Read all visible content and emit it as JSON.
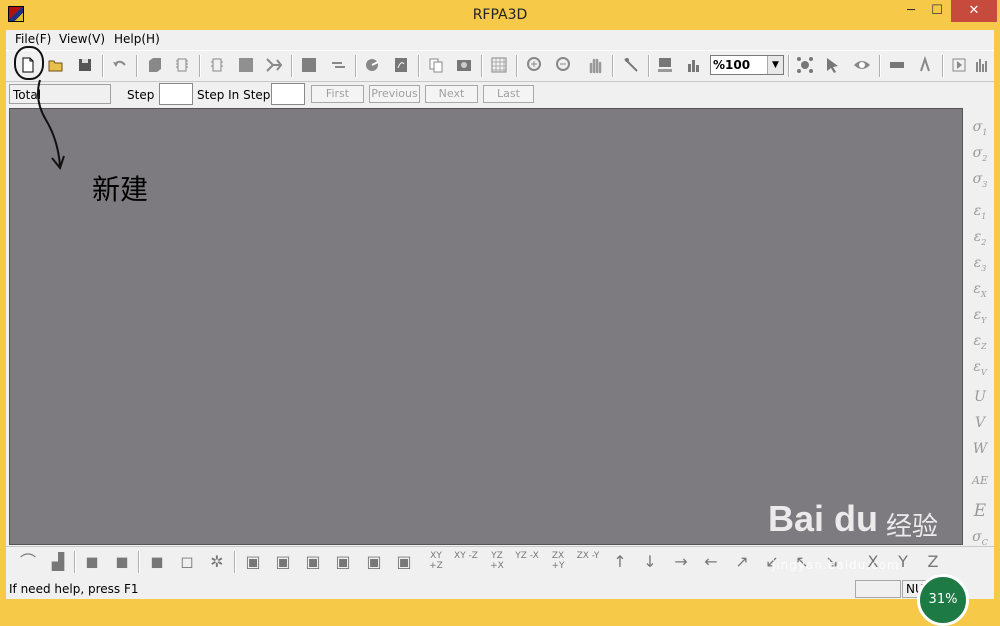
{
  "window": {
    "title": "RFPA3D",
    "min_symbol": "─",
    "max_symbol": "☐",
    "close_symbol": "✕",
    "frame_color": "#f7c948",
    "close_color": "#c74b3c"
  },
  "menu": [
    "File(F)",
    "View(V)",
    "Help(H)"
  ],
  "toolbar": {
    "zoom_value": "%100",
    "icons": [
      "new-file-icon",
      "open-folder-icon",
      "save-icon",
      "undo-icon",
      "cube-icon",
      "chip-icon",
      "chip-plus-icon",
      "grey-square-icon",
      "split-arrow-icon",
      "solid-square-icon",
      "minus-icon",
      "spin-icon",
      "drawing-icon",
      "copy-icon",
      "photo-icon",
      "grid-icon",
      "zoom-in-icon",
      "zoom-out-icon",
      "hand-icon",
      "pen-icon",
      "computer-icon",
      "bar-chart-icon",
      "network-icon",
      "pointer-icon",
      "eye-icon",
      "bar-icon",
      "animation-icon",
      "play-icon",
      "histogram-icon"
    ]
  },
  "stepbar": {
    "total_label": "Total",
    "step_label": "Step",
    "step_value": "",
    "step_in_step_label": "Step In Step",
    "step_in_step_value": "",
    "first": "First",
    "previous": "Previous",
    "next": "Next",
    "last": "Last"
  },
  "right_bar": {
    "items": [
      {
        "sym": "σ",
        "sub": "1"
      },
      {
        "sym": "σ",
        "sub": "2"
      },
      {
        "sym": "σ",
        "sub": "3"
      },
      {
        "sym": "ε",
        "sub": "1"
      },
      {
        "sym": "ε",
        "sub": "2"
      },
      {
        "sym": "ε",
        "sub": "3"
      },
      {
        "sym": "ε",
        "sub": "X"
      },
      {
        "sym": "ε",
        "sub": "Y"
      },
      {
        "sym": "ε",
        "sub": "Z"
      },
      {
        "sym": "ε",
        "sub": "V"
      },
      {
        "sym": "U",
        "sub": ""
      },
      {
        "sym": "V",
        "sub": ""
      },
      {
        "sym": "W",
        "sub": ""
      },
      {
        "sym": "AE",
        "sub": ""
      },
      {
        "sym": "E",
        "sub": ""
      },
      {
        "sym": "σ",
        "sub": "C"
      }
    ]
  },
  "bottom_bar": {
    "axis_buttons": [
      "XY +Z",
      "XY -Z",
      "YZ +X",
      "YZ -X",
      "ZX +Y",
      "ZX -Y"
    ],
    "arrows": [
      "↑",
      "↓",
      "→",
      "←",
      "↗",
      "↙",
      "↖",
      "↘"
    ],
    "axes": [
      "X",
      "Y",
      "Z"
    ]
  },
  "status": {
    "help_text": "If need help, press F1",
    "num_panel": "NUM",
    "percent": "31%"
  },
  "annotation": {
    "label": "新建"
  },
  "watermark": {
    "brand": "Bai du",
    "brand_cn": "经验",
    "url": "jingyan.baidu.com"
  }
}
